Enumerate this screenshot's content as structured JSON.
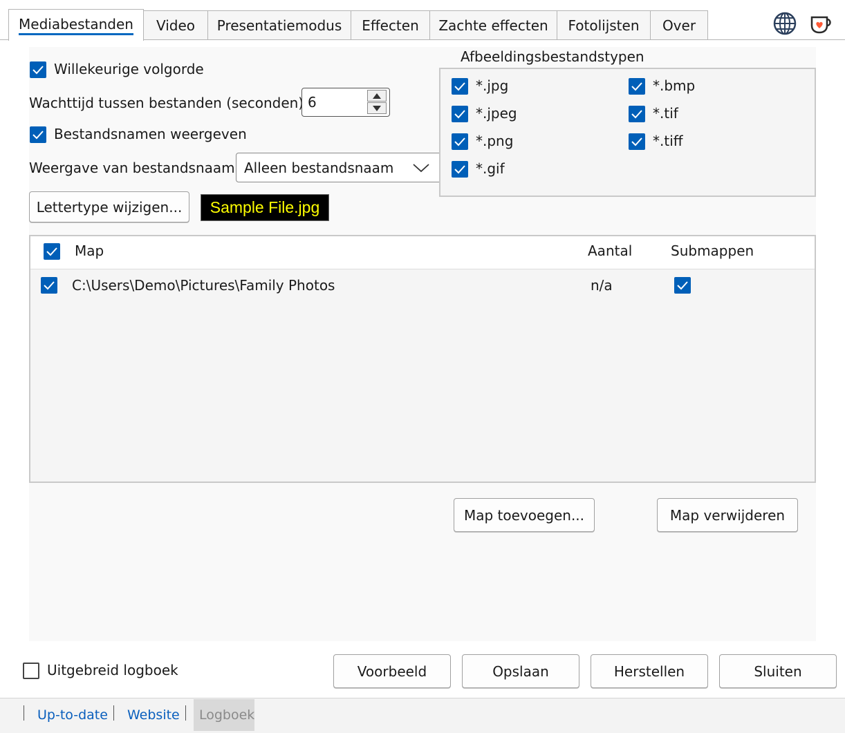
{
  "tabs": [
    {
      "label": "Mediabestanden",
      "active": true
    },
    {
      "label": "Video",
      "active": false
    },
    {
      "label": "Presentatiemodus",
      "active": false
    },
    {
      "label": "Effecten",
      "active": false
    },
    {
      "label": "Zachte effecten",
      "active": false
    },
    {
      "label": "Fotolijsten",
      "active": false
    },
    {
      "label": "Over",
      "active": false
    }
  ],
  "options": {
    "random_order": {
      "label": "Willekeurige volgorde",
      "checked": true
    },
    "wait_time": {
      "label": "Wachttijd tussen bestanden (seconden):",
      "value": "6"
    },
    "show_filenames": {
      "label": "Bestandsnamen weergeven",
      "checked": true
    },
    "filename_display": {
      "label": "Weergave van bestandsnaam:",
      "value": "Alleen bestandsnaam"
    },
    "font_button": "Lettertype wijzigen...",
    "sample_text": "Sample File.jpg",
    "sample_colors": {
      "background": "#000000",
      "text": "#ffff00"
    }
  },
  "file_types": {
    "title": "Afbeeldingsbestandstypen",
    "left": [
      {
        "label": "*.jpg",
        "checked": true
      },
      {
        "label": "*.jpeg",
        "checked": true
      },
      {
        "label": "*.png",
        "checked": true
      },
      {
        "label": "*.gif",
        "checked": true
      }
    ],
    "right": [
      {
        "label": "*.bmp",
        "checked": true
      },
      {
        "label": "*.tif",
        "checked": true
      },
      {
        "label": "*.tiff",
        "checked": true
      }
    ]
  },
  "folders": {
    "columns": [
      "Map",
      "Aantal",
      "Submappen"
    ],
    "header_checked": true,
    "rows": [
      {
        "checked": true,
        "path": "C:\\Users\\Demo\\Pictures\\Family Photos",
        "count": "n/a",
        "subfolders": true
      }
    ],
    "add_button": "Map toevoegen...",
    "remove_button": "Map verwijderen"
  },
  "footer": {
    "verbose_log": {
      "label": "Uitgebreid logboek",
      "checked": false
    },
    "buttons": {
      "preview": "Voorbeeld",
      "save": "Opslaan",
      "reset": "Herstellen",
      "close": "Sluiten"
    }
  },
  "status": {
    "uptodate": "Up-to-date",
    "website": "Website",
    "log": "Logboek"
  },
  "colors": {
    "accent": "#005fb8",
    "link": "#0a5fbd"
  },
  "icons": {
    "language": "globe-icon",
    "donate": "coffee-cup-icon"
  }
}
